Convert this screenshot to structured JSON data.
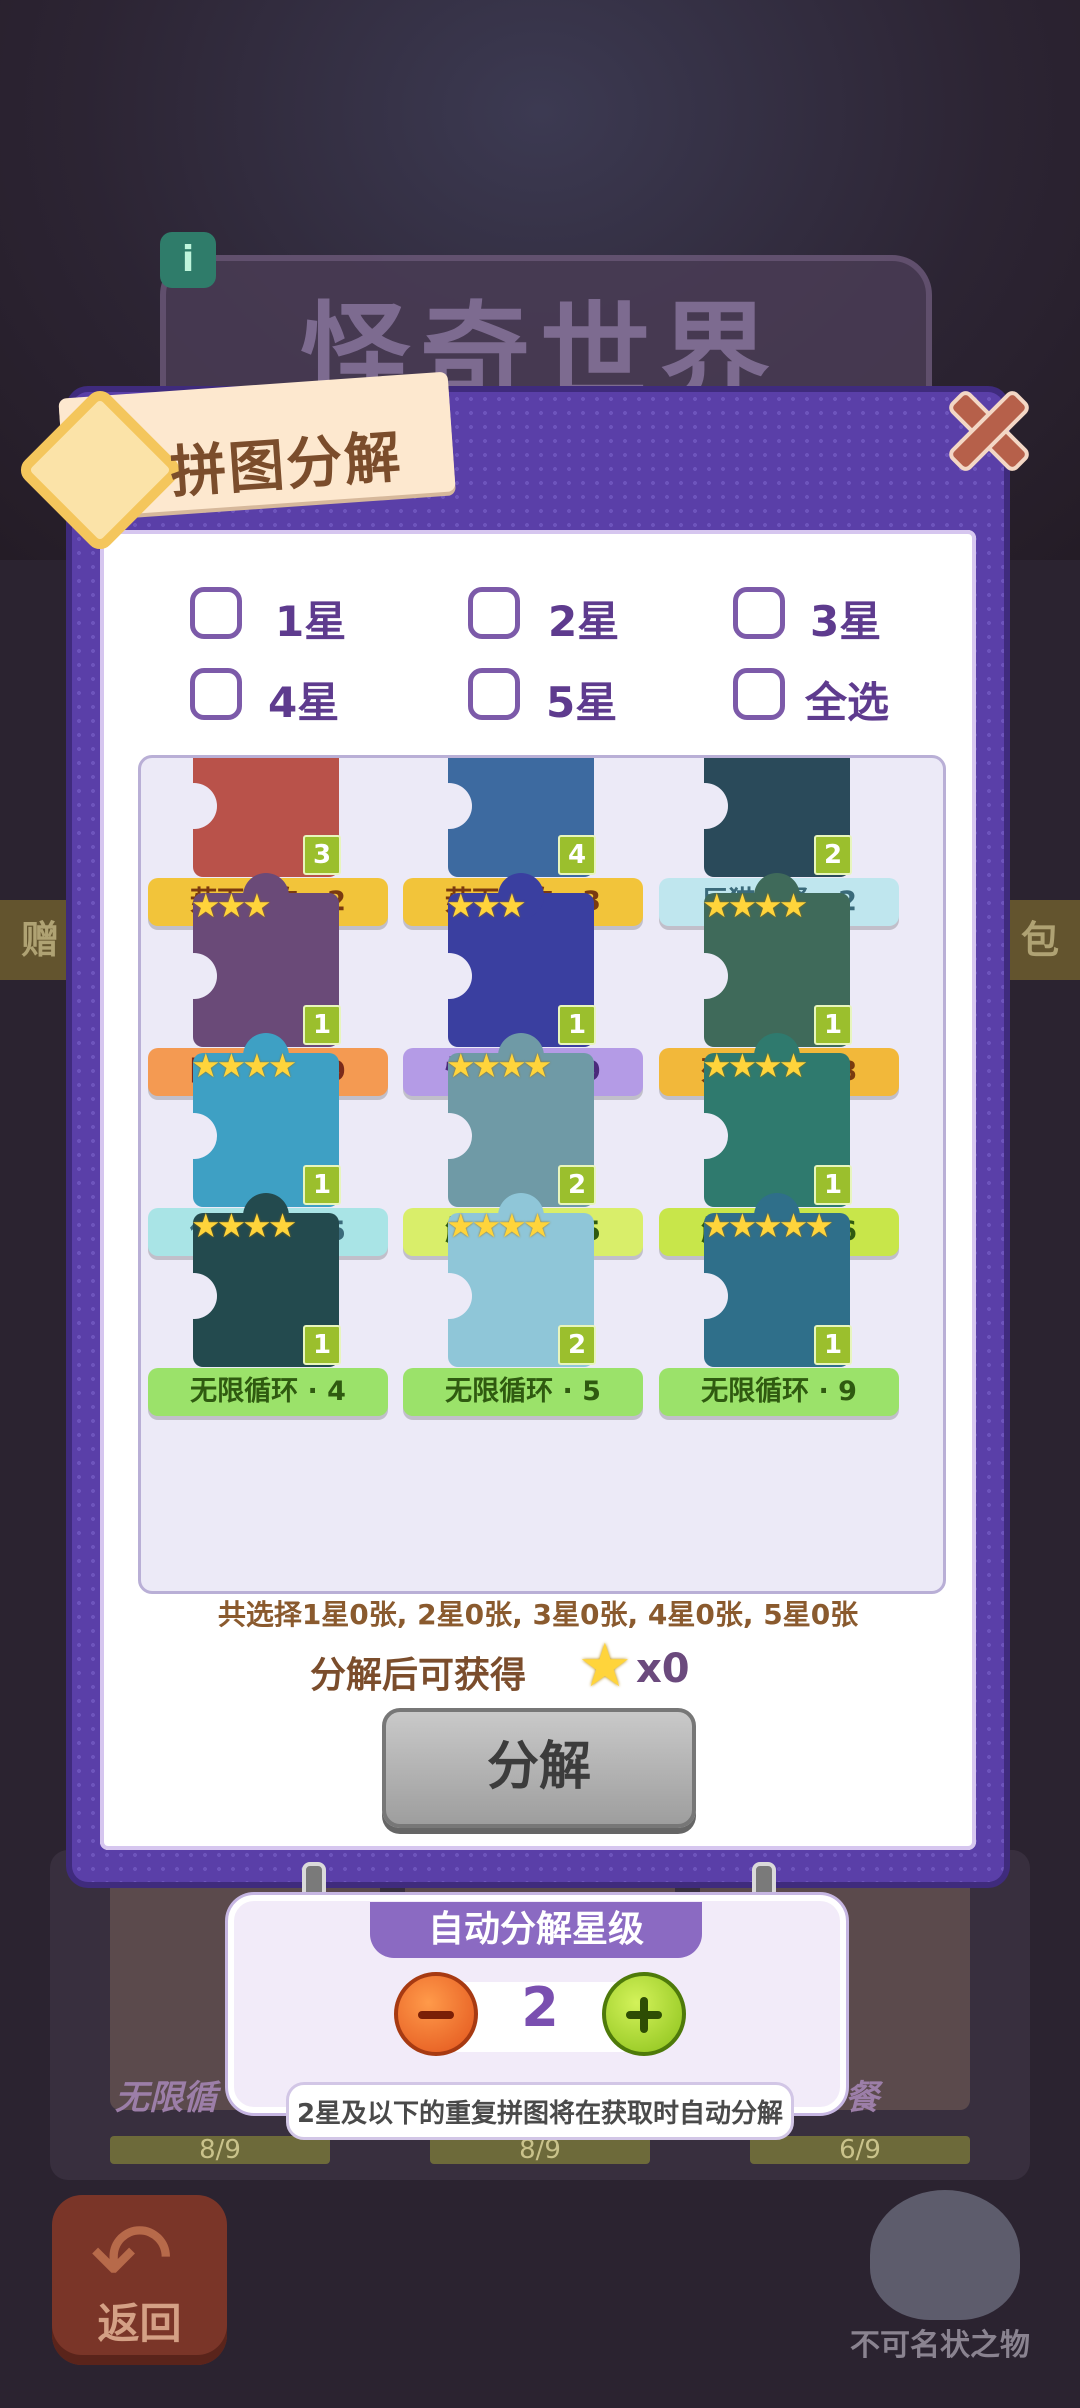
{
  "background": {
    "banner_title": "怪奇世界",
    "side_left": "赠",
    "side_right": "包",
    "bg_card_labels": [
      "无限循",
      "",
      "餐"
    ],
    "bg_progress": [
      "8/9",
      "8/9",
      "6/9"
    ],
    "back_label": "返回",
    "watermark": "不可名状之物"
  },
  "modal": {
    "title": "拼图分解",
    "filters": [
      {
        "label": "1星",
        "checked": false
      },
      {
        "label": "2星",
        "checked": false
      },
      {
        "label": "3星",
        "checked": false
      },
      {
        "label": "4星",
        "checked": false
      },
      {
        "label": "5星",
        "checked": false
      },
      {
        "label": "全选",
        "checked": false
      }
    ],
    "pieces": [
      {
        "name": "菇下垂钓 · 2",
        "stars": "",
        "count": "3",
        "ribbon": "#f2c43a",
        "img": "#b9524a"
      },
      {
        "name": "菇下垂钓 · 3",
        "stars": "",
        "count": "4",
        "ribbon": "#f2c43a",
        "img": "#3d6aa0"
      },
      {
        "name": "巨猫晚餐 · 2",
        "stars": "",
        "count": "2",
        "ribbon": "#bfe6ee",
        "img": "#2a4a5a"
      },
      {
        "name": "阴风阵阵 · 9",
        "stars": "★★★",
        "count": "1",
        "ribbon": "#f49a52",
        "img": "#6a4a78"
      },
      {
        "name": "怪诞小镇 · 9",
        "stars": "★★★",
        "count": "1",
        "ribbon": "#b49be6",
        "img": "#3a3fa0"
      },
      {
        "name": "死神来了 · 8",
        "stars": "★★★★",
        "count": "1",
        "ribbon": "#f2b83a",
        "img": "#3f6a5a"
      },
      {
        "name": "传送阵法 · 5",
        "stars": "★★★★",
        "count": "1",
        "ribbon": "#a9e4e6",
        "img": "#3ea0c4"
      },
      {
        "name": "触手迷宫 · 5",
        "stars": "★★★★",
        "count": "2",
        "ribbon": "#d9ee6a",
        "img": "#6f9aa6"
      },
      {
        "name": "触手迷宫 · 6",
        "stars": "★★★★",
        "count": "1",
        "ribbon": "#c8e64a",
        "img": "#2f7a6e"
      },
      {
        "name": "无限循环 · 4",
        "stars": "★★★★",
        "count": "1",
        "ribbon": "#9be26a",
        "img": "#234a4e"
      },
      {
        "name": "无限循环 · 5",
        "stars": "★★★★",
        "count": "2",
        "ribbon": "#9be26a",
        "img": "#8fc6d8"
      },
      {
        "name": "无限循环 · 9",
        "stars": "★★★★★",
        "count": "1",
        "ribbon": "#9be26a",
        "img": "#2f6f8a"
      }
    ],
    "summary": "共选择1星0张, 2星0张, 3星0张, 4星0张, 5星0张",
    "reward_label": "分解后可获得",
    "reward_value": "x0",
    "decompose_label": "分解"
  },
  "auto": {
    "title": "自动分解星级",
    "value": "2",
    "hint": "2星及以下的重复拼图将在获取时自动分解"
  }
}
